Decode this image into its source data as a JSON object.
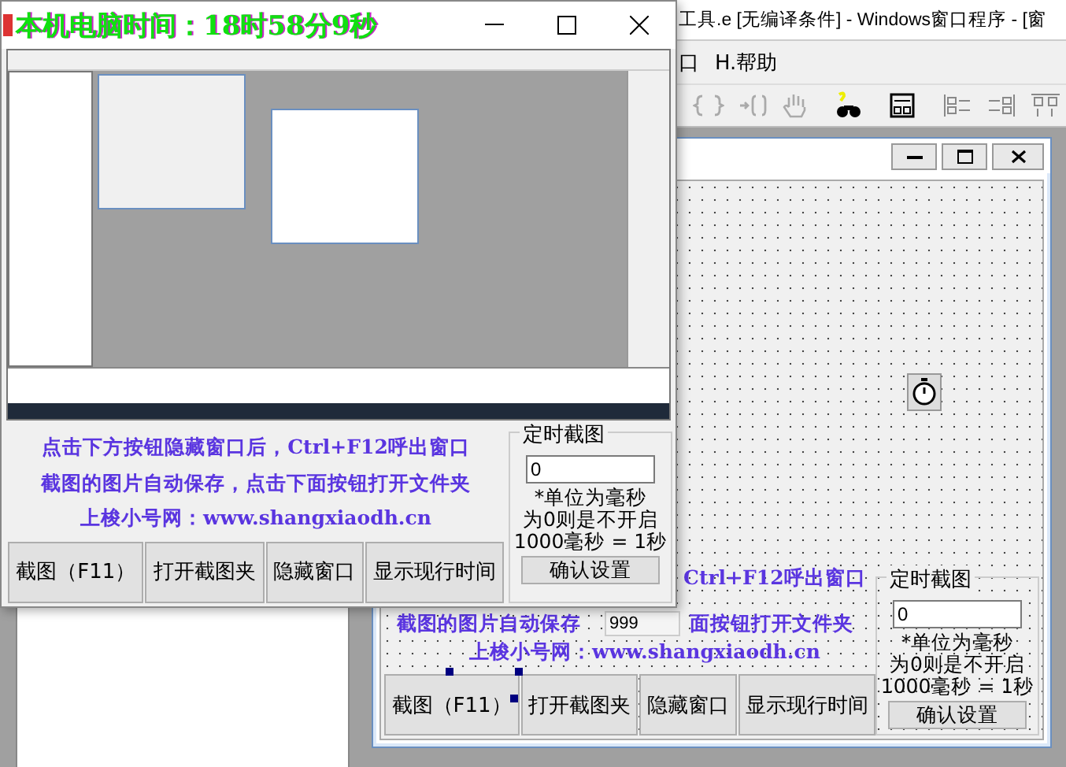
{
  "background_window": {
    "title": "工具.e [无编译条件] - Windows窗口程序 - [窗",
    "menu": [
      {
        "label": "口"
      },
      {
        "label": "H.帮助"
      }
    ]
  },
  "designer_form": {
    "labels": [
      {
        "kind": "line1",
        "text": "Ctrl+F12呼出窗口"
      },
      {
        "kind": "line2a",
        "text": "截图的图片自动保存"
      },
      {
        "kind": "line2b",
        "text": "面按钮打开文件夹"
      },
      {
        "kind": "line3",
        "text": "上梭小号网：www.shangxiaodh.cn"
      }
    ],
    "extra_field": {
      "value": "999"
    },
    "buttons": [
      "截图（F11）",
      "打开截图夹",
      "隐藏窗口",
      "显示现行时间"
    ],
    "timer_group": {
      "title": "定时截图",
      "value": "0",
      "notes": [
        "*单位为毫秒",
        "为0则是不开启",
        "1000毫秒 = 1秒"
      ],
      "button": "确认设置"
    }
  },
  "app_window": {
    "clock": "本机电脑时间：18时58分9秒",
    "labels": [
      "点击下方按钮隐藏窗口后，Ctrl+F12呼出窗口",
      "截图的图片自动保存，点击下面按钮打开文件夹",
      "上梭小号网：www.shangxiaodh.cn"
    ],
    "buttons": [
      "截图（F11）",
      "打开截图夹",
      "隐藏窗口",
      "显示现行时间"
    ],
    "timer_group": {
      "title": "定时截图",
      "value": "0",
      "notes": [
        "*单位为毫秒",
        "为0则是不开启",
        "1000毫秒 = 1秒"
      ],
      "button": "确认设置"
    }
  }
}
